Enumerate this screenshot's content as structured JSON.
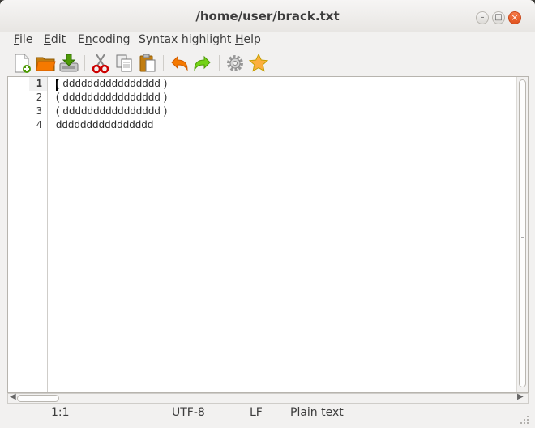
{
  "window": {
    "title": "/home/user/brack.txt"
  },
  "menubar": {
    "file": {
      "mnemonic": "F",
      "rest": "ile"
    },
    "edit": {
      "mnemonic": "E",
      "rest": "dit"
    },
    "encoding": {
      "pre": "E",
      "mnemonic": "n",
      "rest": "coding"
    },
    "syntax": {
      "label": "Syntax highlight"
    },
    "help": {
      "mnemonic": "H",
      "rest": "elp"
    }
  },
  "toolbar": {
    "icons": [
      "new-document-icon",
      "open-folder-icon",
      "save-icon",
      "cut-icon",
      "copy-icon",
      "paste-icon",
      "undo-icon",
      "redo-icon",
      "settings-icon",
      "favorite-star-icon"
    ]
  },
  "editor": {
    "line_numbers": [
      "1",
      "2",
      "3",
      "4"
    ],
    "lines": [
      "( dddddddddddddddd )",
      "( dddddddddddddddd )",
      "( dddddddddddddddd )",
      "dddddddddddddddd"
    ]
  },
  "statusbar": {
    "position": "1:1",
    "encoding": "UTF-8",
    "line_ending": "LF",
    "syntax": "Plain text"
  }
}
